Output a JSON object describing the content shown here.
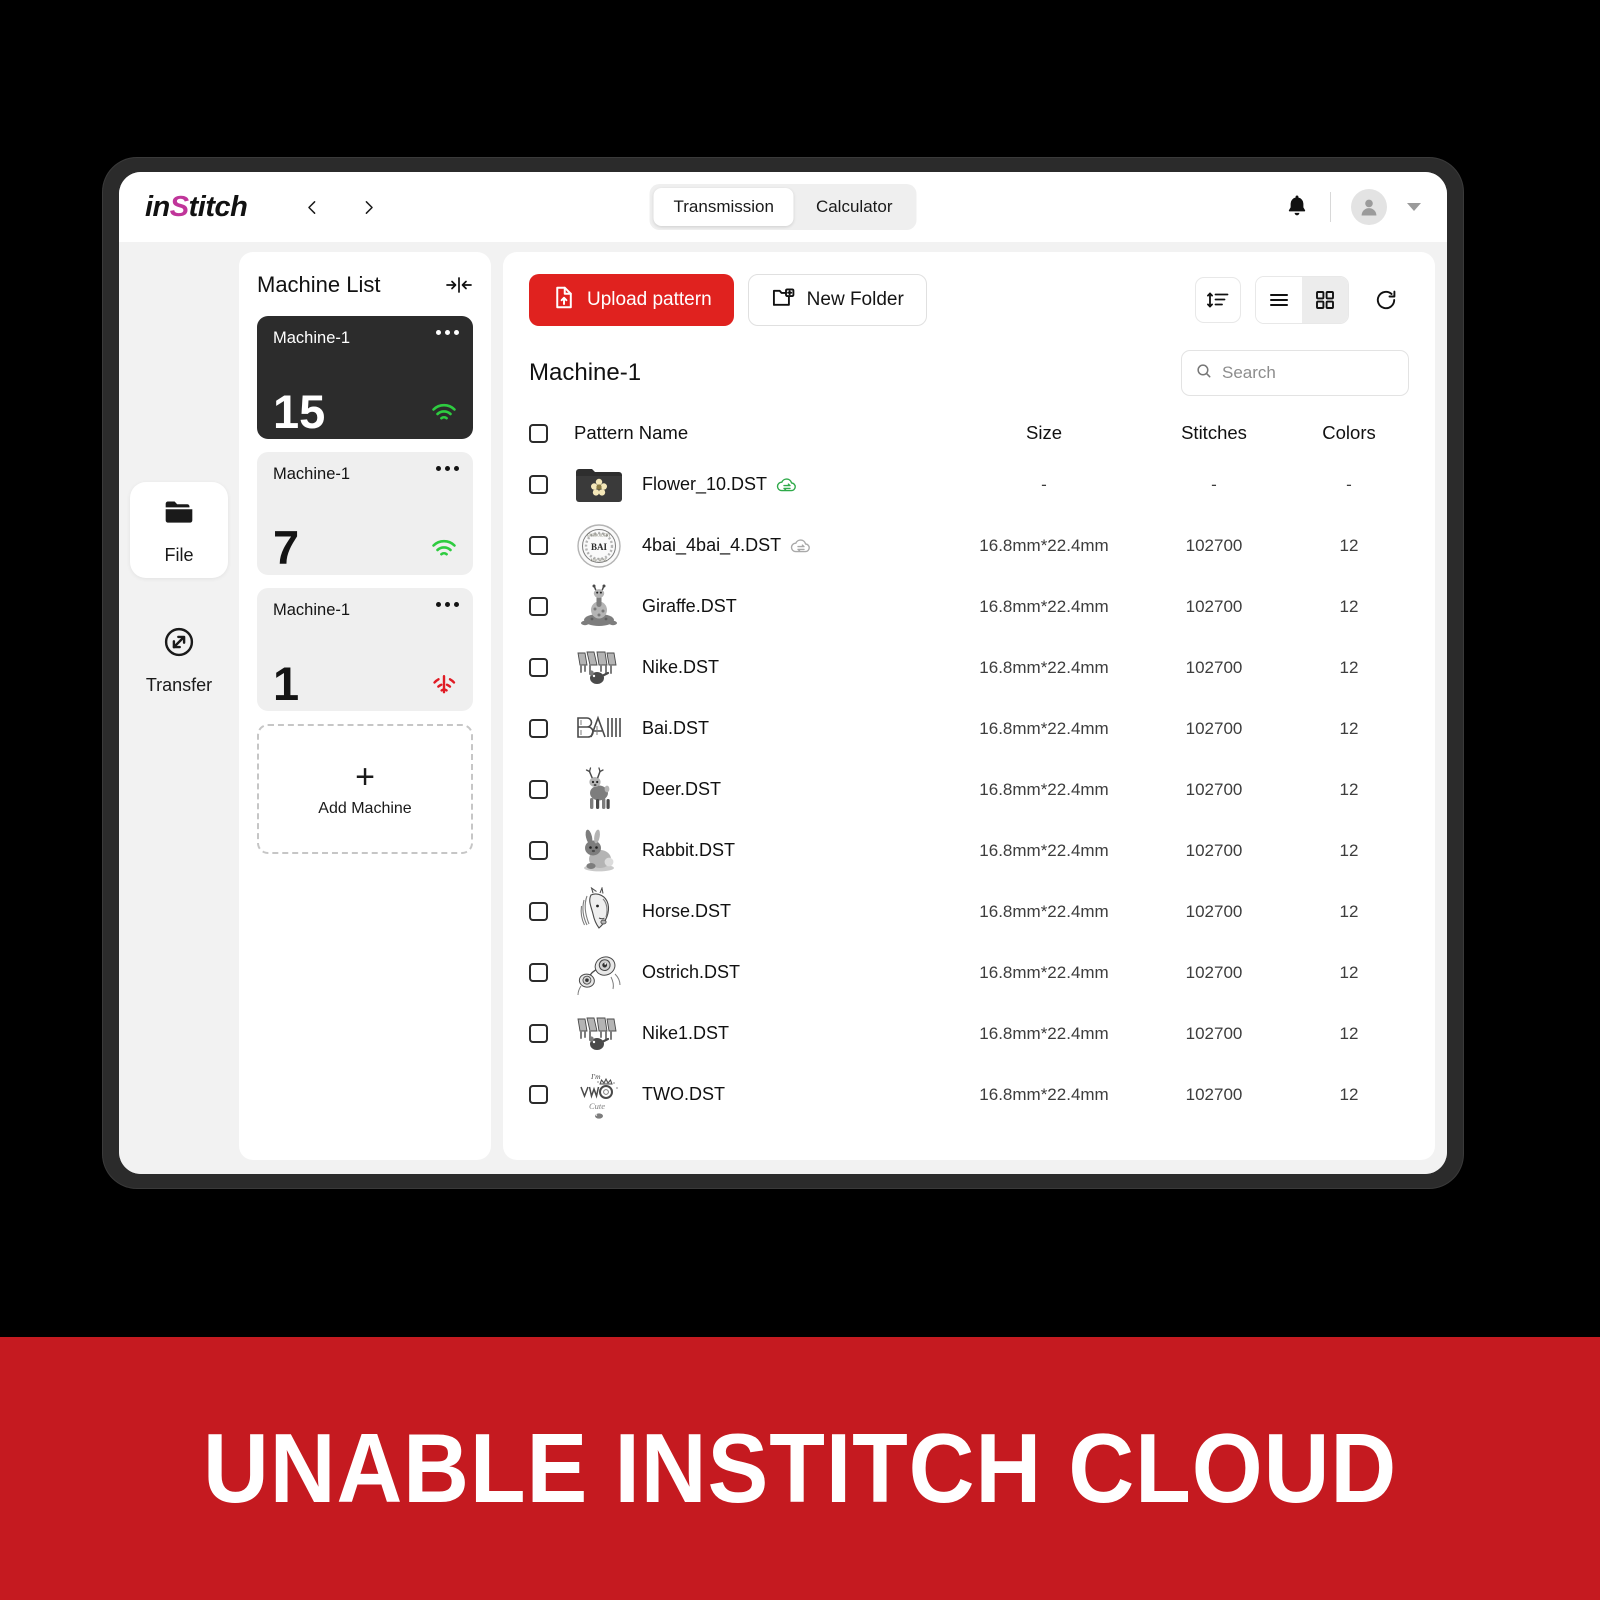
{
  "app": {
    "logo_prefix": "in",
    "logo_accent": "S",
    "logo_suffix": "titch",
    "brand_accent_color": "#c0359a",
    "primary_red": "#e0221f",
    "banner_red": "#c51a20"
  },
  "header": {
    "back_icon": "chevron-left-icon",
    "forward_icon": "chevron-right-icon",
    "tabs": [
      {
        "label": "Transmission",
        "active": true
      },
      {
        "label": "Calculator",
        "active": false
      }
    ],
    "notification_icon": "bell-icon",
    "avatar_icon": "user-avatar-icon",
    "dropdown_icon": "chevron-down-icon"
  },
  "rail": {
    "items": [
      {
        "label": "File",
        "icon": "folder-icon",
        "active": true
      },
      {
        "label": "Transfer",
        "icon": "transfer-icon",
        "active": false
      }
    ]
  },
  "machine_panel": {
    "title": "Machine List",
    "collapse_icon": "collapse-panel-icon",
    "cards": [
      {
        "name": "Machine-1",
        "count": "15",
        "status": "online",
        "active": true
      },
      {
        "name": "Machine-1",
        "count": "7",
        "status": "online",
        "active": false
      },
      {
        "name": "Machine-1",
        "count": "1",
        "status": "offline",
        "active": false
      }
    ],
    "add_machine": {
      "label": "Add Machine",
      "icon": "plus-icon"
    }
  },
  "toolbar": {
    "upload_label": "Upload pattern",
    "upload_icon": "file-upload-icon",
    "new_folder_label": "New Folder",
    "new_folder_icon": "folder-plus-icon",
    "sort_icon": "sort-icon",
    "list_view_icon": "list-view-icon",
    "grid_view_icon": "grid-view-icon",
    "refresh_icon": "refresh-icon"
  },
  "main": {
    "subtitle": "Machine-1",
    "search": {
      "placeholder": "Search",
      "value": "",
      "icon": "search-icon"
    },
    "columns": [
      "Pattern Name",
      "Size",
      "Stitches",
      "Colors"
    ],
    "rows": [
      {
        "name": "Flower_10.DST",
        "thumb": "folder-flower",
        "sync": "green",
        "size": "-",
        "stitches": "-",
        "colors": "-"
      },
      {
        "name": "4bai_4bai_4.DST",
        "thumb": "bai-seal",
        "sync": "gray",
        "size": "16.8mm*22.4mm",
        "stitches": "102700",
        "colors": "12"
      },
      {
        "name": "Giraffe.DST",
        "thumb": "giraffe",
        "sync": "none",
        "size": "16.8mm*22.4mm",
        "stitches": "102700",
        "colors": "12"
      },
      {
        "name": "Nike.DST",
        "thumb": "nike",
        "sync": "none",
        "size": "16.8mm*22.4mm",
        "stitches": "102700",
        "colors": "12"
      },
      {
        "name": "Bai.DST",
        "thumb": "bai-text",
        "sync": "none",
        "size": "16.8mm*22.4mm",
        "stitches": "102700",
        "colors": "12"
      },
      {
        "name": "Deer.DST",
        "thumb": "deer",
        "sync": "none",
        "size": "16.8mm*22.4mm",
        "stitches": "102700",
        "colors": "12"
      },
      {
        "name": "Rabbit.DST",
        "thumb": "rabbit",
        "sync": "none",
        "size": "16.8mm*22.4mm",
        "stitches": "102700",
        "colors": "12"
      },
      {
        "name": "Horse.DST",
        "thumb": "horse",
        "sync": "none",
        "size": "16.8mm*22.4mm",
        "stitches": "102700",
        "colors": "12"
      },
      {
        "name": "Ostrich.DST",
        "thumb": "ostrich",
        "sync": "none",
        "size": "16.8mm*22.4mm",
        "stitches": "102700",
        "colors": "12"
      },
      {
        "name": "Nike1.DST",
        "thumb": "nike",
        "sync": "none",
        "size": "16.8mm*22.4mm",
        "stitches": "102700",
        "colors": "12"
      },
      {
        "name": "TWO.DST",
        "thumb": "two-cute",
        "sync": "none",
        "size": "16.8mm*22.4mm",
        "stitches": "102700",
        "colors": "12"
      }
    ]
  },
  "banner": {
    "text": "UNABLE INSTITCH CLOUD"
  }
}
